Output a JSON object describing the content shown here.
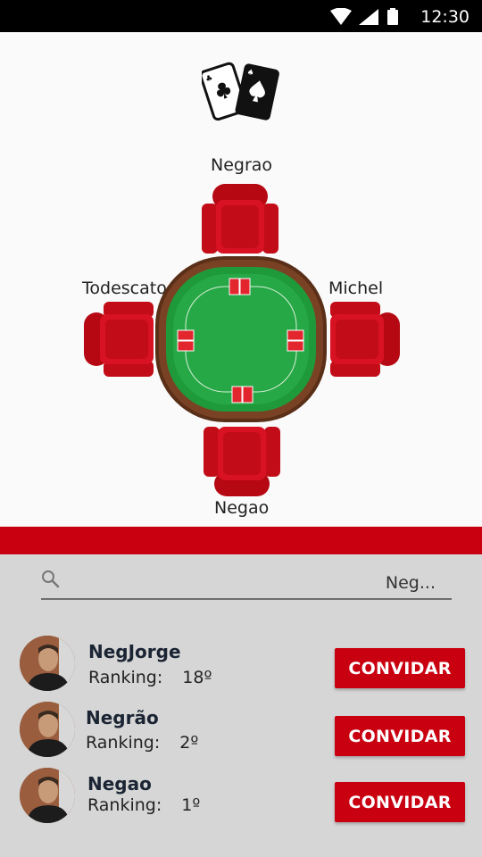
{
  "status_bar": {
    "time": "12:30",
    "icons": [
      "wifi-icon",
      "signal-icon",
      "battery-icon"
    ]
  },
  "table": {
    "seats": {
      "top": "Negrao",
      "left": "Todescato",
      "right": "Michel",
      "bottom": "Negao"
    },
    "colors": {
      "felt": "#1f9a3a",
      "rail": "#6b3a1f",
      "chair": "#d0101c",
      "card": "#e3262e"
    }
  },
  "search": {
    "value": "Neg...",
    "placeholder": ""
  },
  "players": [
    {
      "name": "NegJorge",
      "ranking_label": "Ranking:",
      "ranking": "18º",
      "button": "CONVIDAR"
    },
    {
      "name": "Negrão",
      "ranking_label": "Ranking:",
      "ranking": "2º",
      "button": "CONVIDAR"
    },
    {
      "name": "Negao",
      "ranking_label": "Ranking:",
      "ranking": "1º",
      "button": "CONVIDAR"
    }
  ],
  "accent": "#c90010"
}
